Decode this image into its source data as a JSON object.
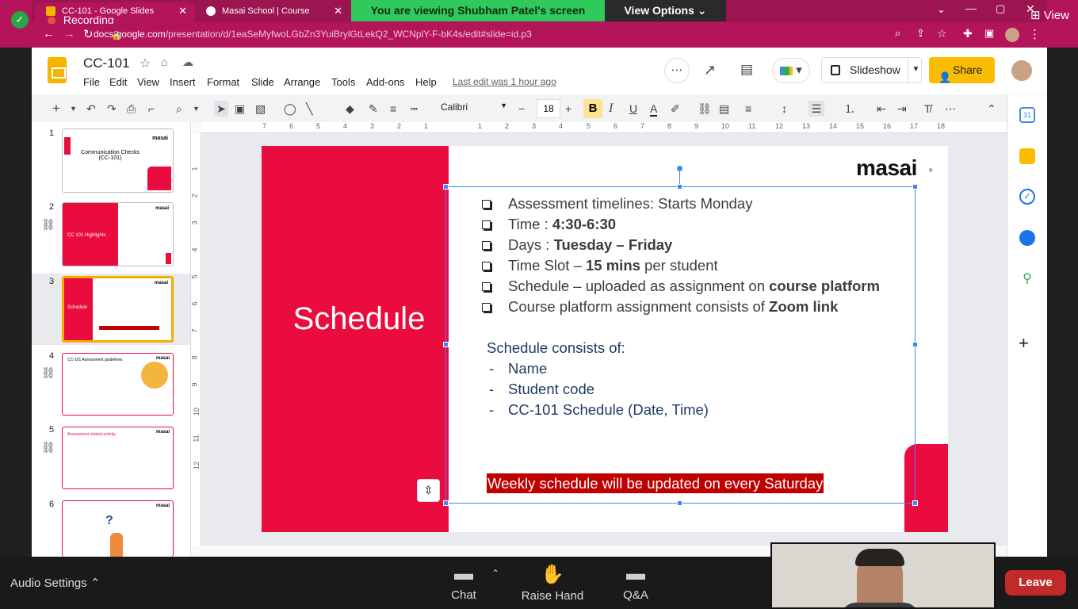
{
  "browser": {
    "tabs": [
      {
        "title": "CC-101 - Google Slides"
      },
      {
        "title": "Masai School | Course"
      }
    ],
    "url_host": "docs.google.com",
    "url_path": "/presentation/d/1eaSeMyfwoLGbZn3YuiBrylGtLekQ2_WCNplY-F-bK4s/edit#slide=id.p3"
  },
  "zoom": {
    "recording": "Recording",
    "banner": "You are viewing Shubham Patel's screen",
    "view_options": "View Options",
    "view_label": "View",
    "audio_settings": "Audio Settings",
    "chat": "Chat",
    "raise_hand": "Raise Hand",
    "qa": "Q&A",
    "leave": "Leave"
  },
  "doc": {
    "title": "CC-101",
    "menu": [
      "File",
      "Edit",
      "View",
      "Insert",
      "Format",
      "Slide",
      "Arrange",
      "Tools",
      "Add-ons",
      "Help"
    ],
    "last_edit": "Last edit was 1 hour ago",
    "slideshow": "Slideshow",
    "share": "Share"
  },
  "toolbar": {
    "font": "Calibri",
    "font_size": "18"
  },
  "rulers": {
    "h": [
      "7",
      "6",
      "5",
      "4",
      "3",
      "2",
      "1",
      "1",
      "2",
      "3",
      "4",
      "5",
      "6",
      "7",
      "8",
      "9",
      "10",
      "11",
      "12",
      "13",
      "14",
      "15",
      "16",
      "17",
      "18"
    ],
    "v": [
      "1",
      "2",
      "3",
      "4",
      "5",
      "6",
      "7",
      "8",
      "9",
      "10",
      "11",
      "12"
    ]
  },
  "filmstrip": {
    "numbers": [
      "1",
      "2",
      "3",
      "4",
      "5",
      "6"
    ],
    "thumb1_title": "Communication Checks (CC-101)",
    "thumb2_title": "CC 101 Highlights",
    "thumb3_title": "Schedule",
    "thumb4_title": "CC-101 Assessment guidelines",
    "thumb5_title": "Assessment related activity",
    "logo": "masai"
  },
  "slide": {
    "title": "Schedule",
    "logo": "masai",
    "bullets": [
      {
        "pre": "  Assessment timelines: Starts  Monday",
        "bold": "",
        "post": ""
      },
      {
        "pre": "Time : ",
        "bold": "4:30-6:30",
        "post": ""
      },
      {
        "pre": "Days : ",
        "bold": "Tuesday – Friday",
        "post": ""
      },
      {
        "pre": "Time Slot – ",
        "bold": "15 mins",
        "post": " per student"
      },
      {
        "pre": "Schedule – uploaded as assignment on ",
        "bold": "course platform",
        "post": ""
      },
      {
        "pre": "Course platform assignment consists of ",
        "bold": "Zoom link",
        "post": ""
      }
    ],
    "schedule_heading": "Schedule consists of:",
    "schedule_items": [
      "Name",
      "Student code",
      "CC-101 Schedule (Date, Time)"
    ],
    "footer_banner": "Weekly schedule will be updated on every  Saturday"
  },
  "colors": {
    "slide_accent": "#ea0c3e",
    "share_button": "#fbbc04",
    "zoom_banner": "#30c95c",
    "leave_button": "#c22a2a"
  }
}
